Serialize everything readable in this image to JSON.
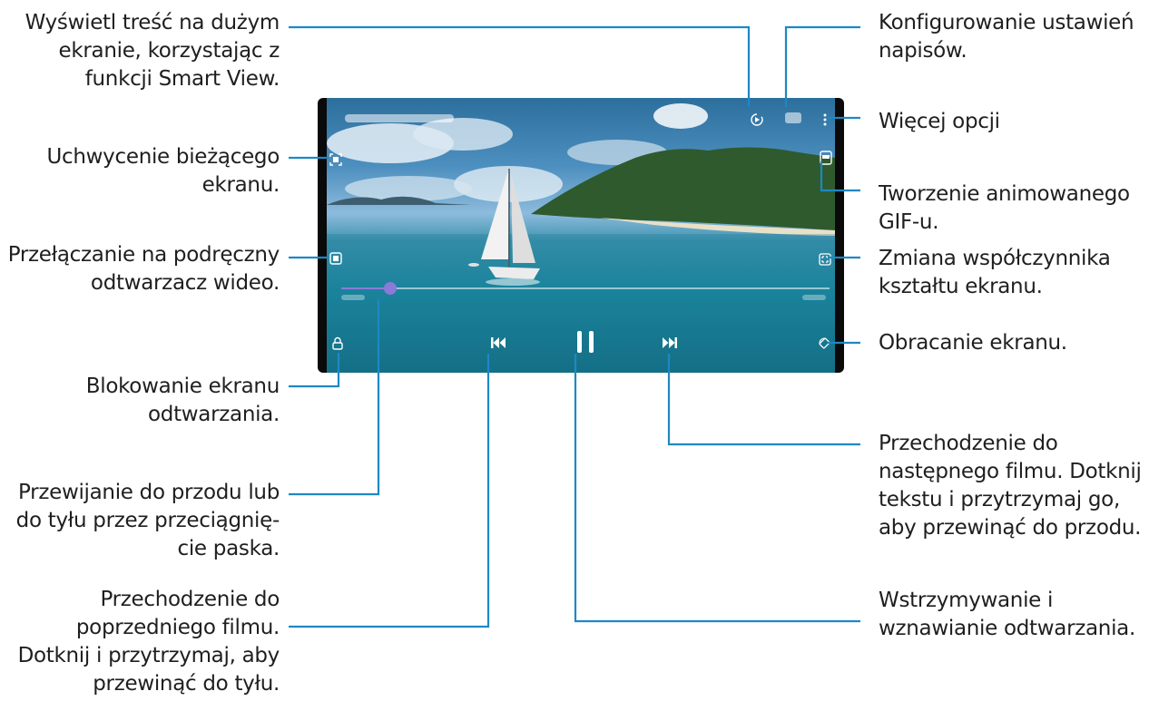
{
  "player": {
    "progress": 0.1
  },
  "annotations": {
    "smart_view": "Wyświetl treść na dużym\nekranie, korzystając z\nfunkcji Smart View.",
    "subtitles": "Konfigurowanie ustawień\nnapisów.",
    "more_options": "Więcej opcji",
    "capture": "Uchwycenie bieżącego\nekranu.",
    "gif": "Tworzenie animowanego\nGIF-u.",
    "popup": "Przełączanie na podręczny\nodtwarzacz wideo.",
    "ratio": "Zmiana współczynnika\nkształtu ekranu.",
    "rotate": "Obracanie ekranu.",
    "lock": "Blokowanie ekranu\nodtwarzania.",
    "seek": "Przewijanie do przodu lub\ndo tyłu przez przeciągnię-\ncie paska.",
    "next": "Przechodzenie do\nnastępnego filmu. Dotknij\ntekstu i przytrzymaj go,\naby przewinąć do przodu.",
    "previous": "Przechodzenie do\npoprzedniego filmu.\nDotknij i przytrzymaj, aby\nprzewinąć do tyłu.",
    "pause": "Wstrzymywanie i\nwznawianie odtwarzania."
  },
  "colors": {
    "leader": "#1e88c4",
    "seek_thumb": "#8b7bd8"
  },
  "icons": {
    "smart_view": "smart-view-icon",
    "subtitles": "subtitles-icon",
    "more": "more-options-icon",
    "capture": "capture-icon",
    "gif": "gif-icon",
    "popup": "popup-player-icon",
    "ratio": "ratio-icon",
    "rotate": "rotate-icon",
    "lock": "lock-icon",
    "previous": "previous-icon",
    "pause": "pause-icon",
    "next": "next-icon"
  }
}
